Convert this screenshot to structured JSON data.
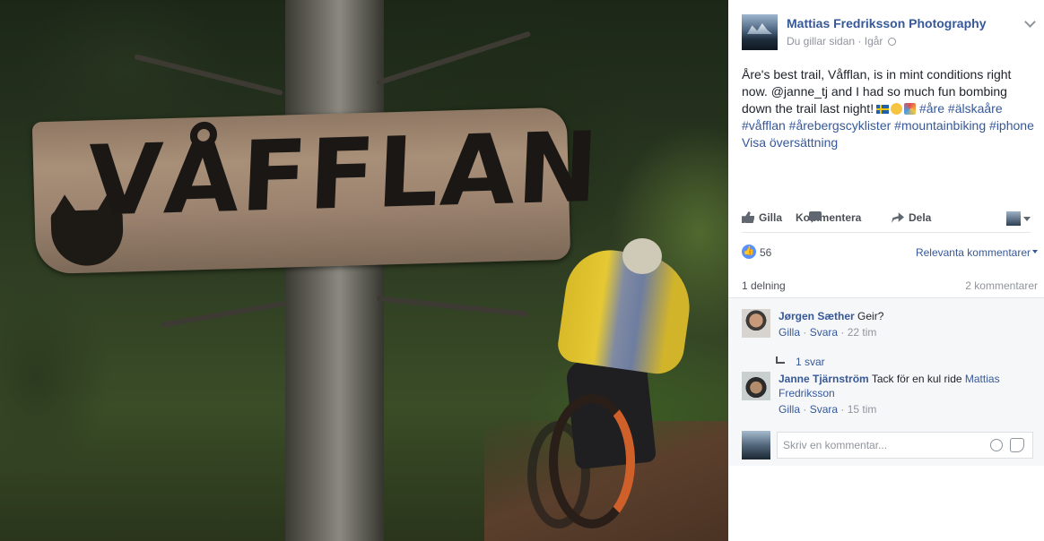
{
  "photo": {
    "sign_text": "VÅFFLAN"
  },
  "post": {
    "page_name": "Mattias Fredriksson Photography",
    "liked_status": "Du gillar sidan",
    "separator": "·",
    "time": "Igår",
    "text_main": "Åre's best trail, Våfflan, is in mint conditions right now. @janne_tj and I had so much fun bombing down the trail last night!",
    "hashtags": [
      "#åre",
      "#älskaåre",
      "#våfflan",
      "#årebergscyklister",
      "#mountainbiking",
      "#iphone"
    ],
    "translate_label": "Visa översättning"
  },
  "actions": {
    "like_label": "Gilla",
    "comment_label": "Kommentera",
    "share_label": "Dela"
  },
  "reactions": {
    "like_count": "56",
    "sort_label": "Relevanta kommentarer"
  },
  "stats": {
    "shares_label": "1 delning",
    "comments_label": "2 kommentarer"
  },
  "comments": [
    {
      "author": "Jørgen Sæther",
      "text": "Geir?",
      "like_label": "Gilla",
      "reply_label": "Svara",
      "time": "22 tim",
      "replies_label": "1 svar"
    },
    {
      "author": "Janne Tjärnström",
      "text": "Tack för en kul ride",
      "mention": "Mattias Fredriksson",
      "like_label": "Gilla",
      "reply_label": "Svara",
      "time": "15 tim"
    }
  ],
  "composer": {
    "placeholder": "Skriv en kommentar..."
  },
  "colors": {
    "link": "#365899",
    "like_badge": "#5890ff",
    "muted": "#90949c"
  }
}
